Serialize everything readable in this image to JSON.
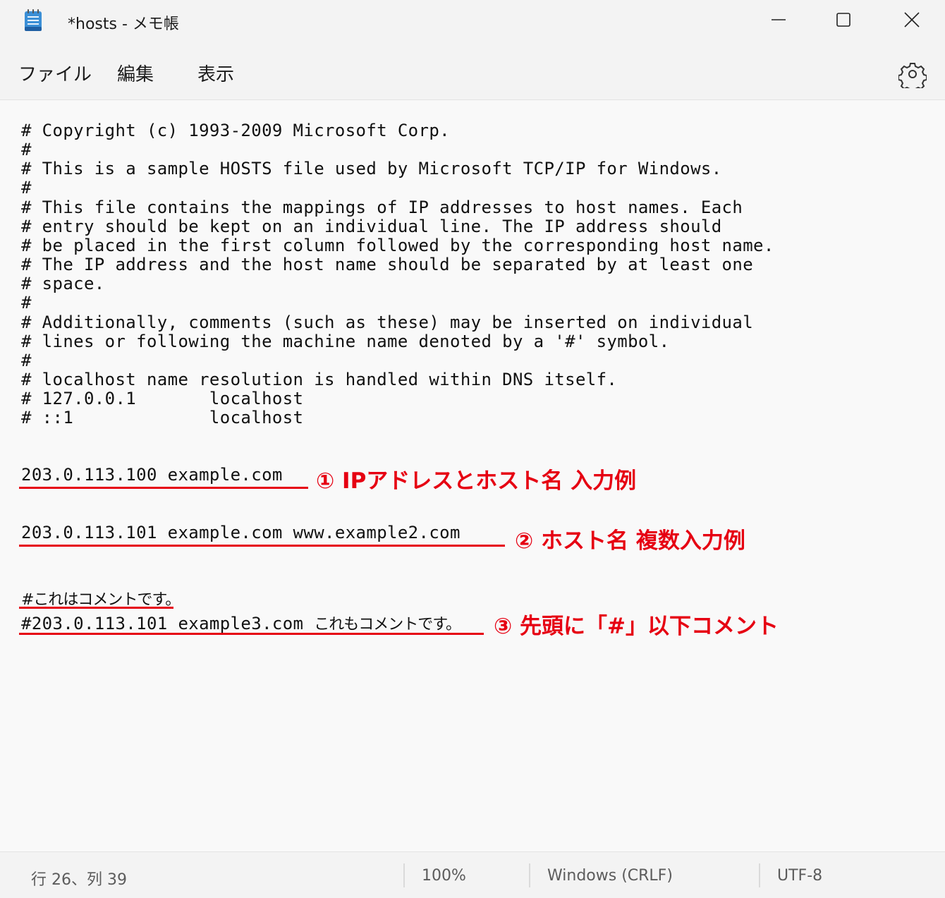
{
  "window": {
    "title": "*hosts - メモ帳",
    "app_icon": "notepad-icon",
    "controls": [
      "minimize-icon",
      "maximize-icon",
      "close-icon"
    ]
  },
  "menu": {
    "file": "ファイル",
    "edit": "編集",
    "view": "表示",
    "settings_icon": "gear-icon"
  },
  "editor": {
    "comment_block": "# Copyright (c) 1993-2009 Microsoft Corp.\n#\n# This is a sample HOSTS file used by Microsoft TCP/IP for Windows.\n#\n# This file contains the mappings of IP addresses to host names. Each\n# entry should be kept on an individual line. The IP address should\n# be placed in the first column followed by the corresponding host name.\n# The IP address and the host name should be separated by at least one\n# space.\n#\n# Additionally, comments (such as these) may be inserted on individual\n# lines or following the machine name denoted by a '#' symbol.\n#\n# localhost name resolution is handled within DNS itself.\n# 127.0.0.1       localhost\n# ::1             localhost",
    "entry1": "203.0.113.100 example.com",
    "entry2": "203.0.113.101 example.com www.example2.com",
    "entry3_comment": "#これはコメントです。",
    "entry4_code": "#203.0.113.101 example3.com ",
    "entry4_jp": "これもコメントです。"
  },
  "annotations": {
    "a1": "① IPアドレスとホスト名 入力例",
    "a2": "② ホスト名 複数入力例",
    "a3": "③ 先頭に「#」以下コメント",
    "color": "#e60012"
  },
  "status": {
    "position": "行 26、列 39",
    "zoom": "100%",
    "line_ending": "Windows (CRLF)",
    "encoding": "UTF-8"
  }
}
